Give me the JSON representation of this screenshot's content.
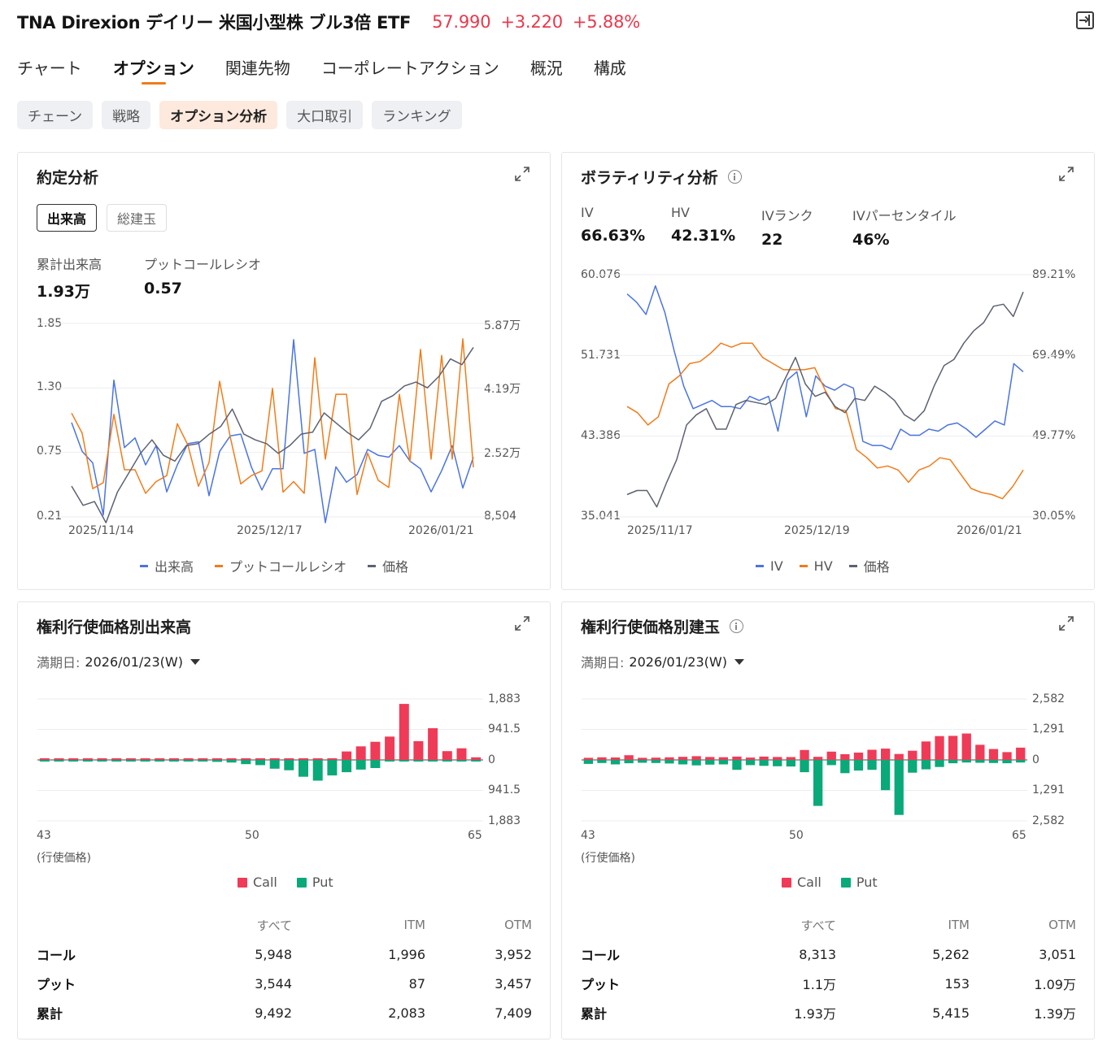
{
  "header": {
    "title": "TNA Direxion デイリー 米国小型株 ブル3倍 ETF",
    "price": "57.990",
    "change": "+3.220",
    "change_pct": "+5.88%",
    "up_color": "#e8394d"
  },
  "tabs": [
    "チャート",
    "オプション",
    "関連先物",
    "コーポレートアクション",
    "概況",
    "構成"
  ],
  "active_tab": 1,
  "subtabs": [
    "チェーン",
    "戦略",
    "オプション分析",
    "大口取引",
    "ランキング"
  ],
  "active_subtab": 2,
  "contract": {
    "title": "約定分析",
    "toggle": [
      "出来高",
      "総建玉"
    ],
    "stat1_label": "累計出来高",
    "stat1_value": "1.93万",
    "stat2_label": "プットコールレシオ",
    "stat2_value": "0.57",
    "left_ticks": [
      "1.85",
      "1.30",
      "0.75",
      "0.21"
    ],
    "right_ticks": [
      "5.87万",
      "4.19万",
      "2.52万",
      "8,504"
    ],
    "x_ticks": [
      "2025/11/14",
      "2025/12/17",
      "2026/01/21"
    ],
    "legend": [
      "出来高",
      "プットコールレシオ",
      "価格"
    ]
  },
  "volatility": {
    "title": "ボラティリティ分析",
    "stats": [
      {
        "label": "IV",
        "value": "66.63%"
      },
      {
        "label": "HV",
        "value": "42.31%"
      },
      {
        "label": "IVランク",
        "value": "22"
      },
      {
        "label": "IVパーセンタイル",
        "value": "46%"
      }
    ],
    "left_ticks": [
      "60.076",
      "51.731",
      "43.386",
      "35.041"
    ],
    "right_ticks": [
      "89.21%",
      "69.49%",
      "49.77%",
      "30.05%"
    ],
    "x_ticks": [
      "2025/11/17",
      "2025/12/19",
      "2026/01/21"
    ],
    "legend": [
      "IV",
      "HV",
      "価格"
    ]
  },
  "strike_volume": {
    "title": "権利行使価格別出来高",
    "expiry_label": "満期日:",
    "expiry_value": "2026/01/23(W)",
    "y_ticks": [
      "1,883",
      "941.5",
      "0",
      "941.5",
      "1,883"
    ],
    "x_ticks": [
      "43",
      "50",
      "65"
    ],
    "x_unit": "(行使価格)",
    "legend": [
      "Call",
      "Put"
    ],
    "table": {
      "headers": [
        "すべて",
        "ITM",
        "OTM"
      ],
      "rows": [
        {
          "label": "コール",
          "all": "5,948",
          "itm": "1,996",
          "otm": "3,952"
        },
        {
          "label": "プット",
          "all": "3,544",
          "itm": "87",
          "otm": "3,457"
        },
        {
          "label": "累計",
          "all": "9,492",
          "itm": "2,083",
          "otm": "7,409"
        }
      ]
    }
  },
  "strike_oi": {
    "title": "権利行使価格別建玉",
    "expiry_label": "満期日:",
    "expiry_value": "2026/01/23(W)",
    "y_ticks": [
      "2,582",
      "1,291",
      "0",
      "1,291",
      "2,582"
    ],
    "x_ticks": [
      "43",
      "50",
      "65"
    ],
    "x_unit": "(行使価格)",
    "legend": [
      "Call",
      "Put"
    ],
    "table": {
      "headers": [
        "すべて",
        "ITM",
        "OTM"
      ],
      "rows": [
        {
          "label": "コール",
          "all": "8,313",
          "itm": "5,262",
          "otm": "3,051"
        },
        {
          "label": "プット",
          "all": "1.1万",
          "itm": "153",
          "otm": "1.09万"
        },
        {
          "label": "累計",
          "all": "1.93万",
          "itm": "5,415",
          "otm": "1.39万"
        }
      ]
    }
  },
  "colors": {
    "blue": "#4a74e0",
    "orange": "#f07c1a",
    "gray": "#5b6270",
    "call": "#ef3b57",
    "put": "#0aa979",
    "accent": "#f07c1a"
  },
  "chart_data": [
    {
      "type": "line",
      "title": "約定分析",
      "x_ticks": [
        "2025/11/14",
        "2025/12/17",
        "2026/01/21"
      ],
      "left_axis_range": [
        0.21,
        1.85
      ],
      "right_axis_range": [
        8504,
        58700
      ],
      "series": [
        {
          "name": "出来高",
          "axis": "right",
          "values": [
            33000,
            25500,
            22500,
            9000,
            44000,
            26500,
            29000,
            22000,
            27000,
            15000,
            22000,
            27500,
            28000,
            14000,
            25500,
            29500,
            30000,
            21500,
            15500,
            21000,
            21000,
            54500,
            25000,
            26000,
            7000,
            21500,
            17500,
            19500,
            26000,
            24500,
            24000,
            27000,
            23000,
            21000,
            15000,
            20500,
            27000,
            16000,
            24000
          ]
        },
        {
          "name": "プットコールレシオ",
          "axis": "left",
          "values": [
            1.09,
            0.92,
            0.45,
            0.5,
            1.08,
            0.61,
            0.61,
            0.41,
            0.51,
            0.56,
            1.0,
            0.82,
            0.47,
            0.67,
            1.36,
            0.89,
            0.49,
            0.56,
            0.6,
            1.3,
            0.42,
            0.51,
            0.41,
            1.56,
            0.7,
            1.25,
            1.25,
            0.4,
            0.75,
            0.52,
            0.46,
            1.25,
            0.68,
            1.63,
            0.7,
            1.58,
            0.7,
            1.72,
            0.63
          ]
        },
        {
          "name": "価格",
          "axis": "right",
          "values": [
            16500,
            11500,
            12500,
            7000,
            15000,
            20000,
            25000,
            28500,
            24500,
            23000,
            27000,
            27500,
            30000,
            32000,
            36500,
            30000,
            28500,
            27500,
            25000,
            27000,
            30000,
            30500,
            35500,
            33000,
            30500,
            28500,
            31500,
            38500,
            40000,
            42500,
            43500,
            42000,
            45000,
            49500,
            48000,
            52500
          ]
        }
      ]
    },
    {
      "type": "line",
      "title": "ボラティリティ分析",
      "x_ticks": [
        "2025/11/17",
        "2025/12/19",
        "2026/01/21"
      ],
      "left_axis_range": [
        35.041,
        60.076
      ],
      "right_axis_range": [
        30.05,
        89.21
      ],
      "series": [
        {
          "name": "IV",
          "axis": "right",
          "values": [
            84.5,
            82.5,
            79.5,
            86.5,
            80.0,
            70.5,
            62.0,
            56.5,
            57.5,
            58.5,
            57.0,
            57.0,
            56.5,
            59.5,
            58.5,
            59.5,
            51.0,
            63.5,
            65.5,
            54.5,
            64.5,
            62.0,
            61.0,
            62.5,
            61.5,
            48.5,
            47.5,
            47.5,
            46.5,
            51.5,
            50.0,
            50.0,
            51.5,
            51.0,
            52.5,
            53.0,
            51.5,
            49.5,
            51.5,
            53.5,
            52.5,
            67.5,
            65.5
          ]
        },
        {
          "name": "HV",
          "axis": "right",
          "values": [
            57.0,
            55.5,
            52.5,
            54.5,
            62.5,
            64.5,
            67.5,
            68.0,
            70.0,
            72.5,
            71.5,
            72.5,
            72.5,
            69.0,
            67.5,
            66.0,
            66.0,
            66.0,
            66.5,
            61.0,
            56.5,
            56.0,
            46.5,
            44.5,
            42.0,
            42.5,
            41.5,
            38.5,
            41.5,
            42.5,
            44.5,
            44.0,
            40.5,
            37.0,
            36.0,
            35.5,
            34.5,
            37.5,
            41.5
          ]
        },
        {
          "name": "価格",
          "axis": "right",
          "values": [
            35.5,
            36.5,
            36.5,
            32.5,
            38.5,
            44.0,
            52.5,
            55.0,
            56.5,
            51.5,
            51.5,
            57.5,
            58.5,
            58.0,
            57.5,
            59.0,
            64.0,
            69.0,
            62.5,
            59.5,
            60.5,
            57.0,
            55.5,
            59.0,
            58.5,
            62.0,
            60.5,
            58.5,
            55.0,
            53.5,
            56.0,
            62.0,
            67.0,
            68.5,
            72.5,
            75.5,
            77.5,
            81.5,
            82.0,
            79.0,
            85.0
          ]
        }
      ]
    },
    {
      "type": "bar",
      "title": "権利行使価格別出来高",
      "x_ticks": [
        "43",
        "50",
        "65"
      ],
      "ylim": [
        -1883,
        1883
      ],
      "series": [
        {
          "name": "Call",
          "values": [
            30,
            35,
            45,
            40,
            35,
            40,
            35,
            30,
            25,
            30,
            30,
            35,
            30,
            30,
            25,
            20,
            25,
            30,
            25,
            30,
            40,
            260,
            420,
            560,
            720,
            1730,
            580,
            980,
            270,
            360,
            80
          ]
        },
        {
          "name": "Put",
          "values": [
            -25,
            -30,
            -40,
            -45,
            -50,
            -40,
            -35,
            -40,
            -45,
            -35,
            -40,
            -50,
            -60,
            -80,
            -130,
            -160,
            -270,
            -320,
            -520,
            -640,
            -480,
            -380,
            -300,
            -250,
            -30,
            -25,
            -20,
            -25,
            -30,
            -35,
            -40
          ]
        }
      ]
    },
    {
      "type": "bar",
      "title": "権利行使価格別建玉",
      "x_ticks": [
        "43",
        "50",
        "65"
      ],
      "ylim": [
        -2582,
        2582
      ],
      "series": [
        {
          "name": "Call",
          "values": [
            90,
            110,
            105,
            200,
            90,
            95,
            110,
            130,
            160,
            125,
            115,
            140,
            100,
            140,
            125,
            120,
            420,
            130,
            350,
            240,
            310,
            430,
            480,
            250,
            390,
            780,
            1010,
            1020,
            1120,
            640,
            460,
            330,
            520
          ]
        },
        {
          "name": "Put",
          "values": [
            -170,
            -130,
            -190,
            -140,
            -120,
            -130,
            -150,
            -190,
            -230,
            -200,
            -190,
            -420,
            -220,
            -250,
            -270,
            -280,
            -520,
            -1950,
            -220,
            -560,
            -450,
            -420,
            -1280,
            -2330,
            -540,
            -400,
            -300,
            -140,
            -110,
            -120,
            -130,
            -140,
            -110
          ]
        }
      ]
    }
  ]
}
